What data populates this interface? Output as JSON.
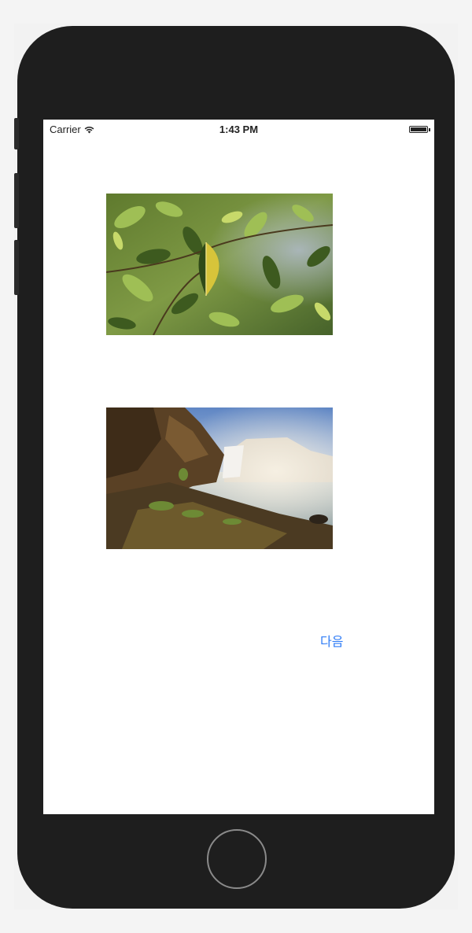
{
  "status_bar": {
    "carrier": "Carrier",
    "time": "1:43 PM",
    "wifi_icon": "wifi-icon",
    "battery_icon": "battery-icon"
  },
  "images": [
    {
      "name": "leaves-photo"
    },
    {
      "name": "waterfall-photo"
    }
  ],
  "next_button": {
    "label": "다음",
    "color": "#2f7cf6"
  },
  "device": {
    "frame_color": "#1e1e1e",
    "home_button_icon": "home-button"
  }
}
